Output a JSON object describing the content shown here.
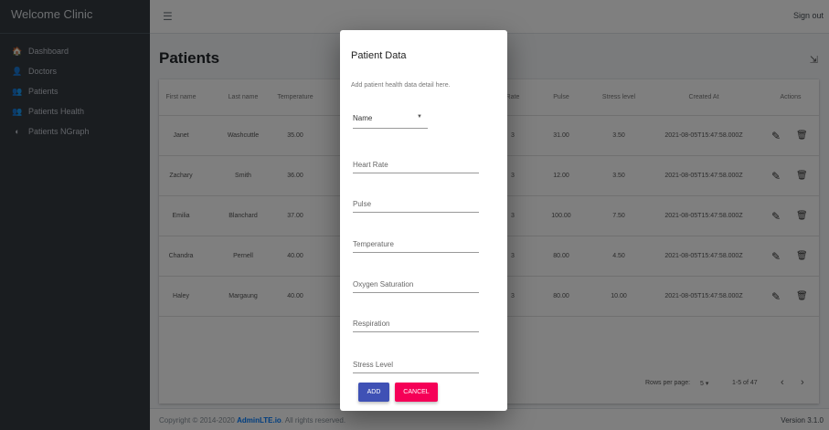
{
  "brand": {
    "title": "Welcome Clinic"
  },
  "sidebar": {
    "items": [
      {
        "label": "Dashboard",
        "icon": "home-icon",
        "glyph": "🏠"
      },
      {
        "label": "Doctors",
        "icon": "user-icon",
        "glyph": "👤"
      },
      {
        "label": "Patients",
        "icon": "users-icon",
        "glyph": "👥"
      },
      {
        "label": "Patients Health",
        "icon": "users-icon",
        "glyph": "👥"
      },
      {
        "label": "Patients NGraph",
        "icon": "chart-icon",
        "glyph": "◐"
      }
    ]
  },
  "topbar": {
    "menu_icon": "☰",
    "signout_label": "Sign out"
  },
  "page": {
    "title": "Patients",
    "export_icon": "⇲"
  },
  "table": {
    "headers": [
      "First name",
      "Last name",
      "Temperature",
      "Rate",
      "Pulse",
      "Stress level",
      "Created At",
      "Actions"
    ],
    "rows": [
      [
        "Janet",
        "Washcuttle",
        "35.00",
        "3",
        "31.00",
        "3.50",
        "2021-08-05T15:47:58.000Z"
      ],
      [
        "Zachary",
        "Smith",
        "36.00",
        "3",
        "12.00",
        "3.50",
        "2021-08-05T15:47:58.000Z"
      ],
      [
        "Emilia",
        "Blanchard",
        "37.00",
        "3",
        "100.00",
        "7.50",
        "2021-08-05T15:47:58.000Z"
      ],
      [
        "Chandra",
        "Pernell",
        "40.00",
        "3",
        "80.00",
        "4.50",
        "2021-08-05T15:47:58.000Z"
      ],
      [
        "Haley",
        "Margaung",
        "40.00",
        "3",
        "80.00",
        "10.00",
        "2021-08-05T15:47:58.000Z"
      ]
    ],
    "edit_icon": "✎",
    "delete_icon": "🗑",
    "pagination": {
      "rows_per_page_label": "Rows per page:",
      "rows_per_page_value": "5 ▾",
      "range": "1-5 of 47",
      "prev": "‹",
      "next": "›"
    }
  },
  "footer": {
    "copyright": "Copyright © 2014-2020 ",
    "link": "AdminLTE.io",
    "rights": ". All rights reserved.",
    "version": "Version 3.1.0"
  },
  "dialog": {
    "title": "Patient Data",
    "subtitle": "Add patient health data detail here.",
    "select": {
      "value": "Name",
      "caret": "▼"
    },
    "fields": [
      {
        "placeholder": "Heart Rate"
      },
      {
        "placeholder": "Pulse"
      },
      {
        "placeholder": "Temperature"
      },
      {
        "placeholder": "Oxygen Saturation"
      },
      {
        "placeholder": "Respiration"
      },
      {
        "placeholder": "Stress Level"
      }
    ],
    "add_label": "ADD",
    "cancel_label": "CANCEL"
  },
  "colors": {
    "sidebar": "#343a40",
    "primary": "#3f51b5",
    "secondary": "#f50057",
    "link": "#007bff"
  }
}
